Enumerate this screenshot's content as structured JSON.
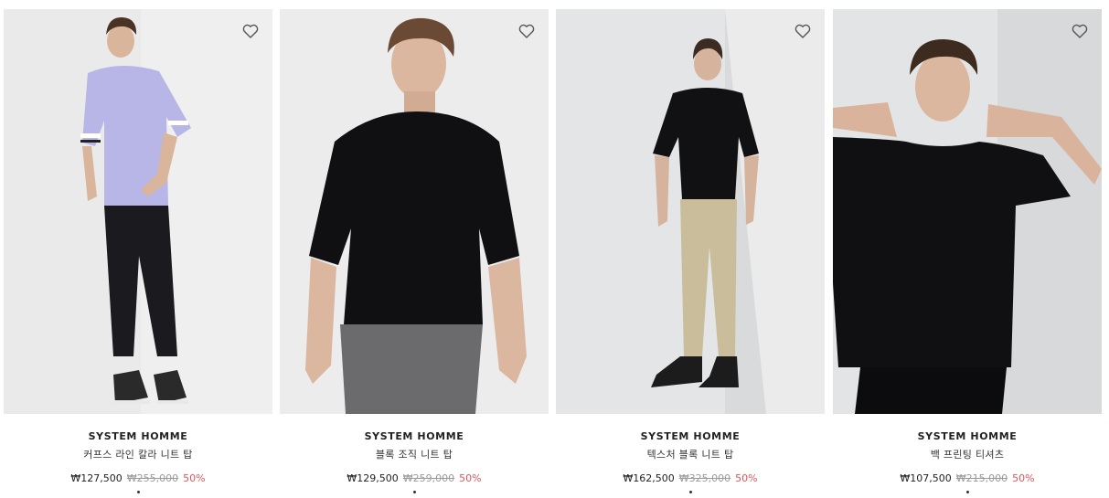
{
  "products": [
    {
      "brand": "SYSTEM HOMME",
      "name": "커프스 라인 칼라 니트 탑",
      "price": "₩127,500",
      "original_price": "₩255,000",
      "discount": "50%"
    },
    {
      "brand": "SYSTEM HOMME",
      "name": "블록 조직 니트 탑",
      "price": "₩129,500",
      "original_price": "₩259,000",
      "discount": "50%"
    },
    {
      "brand": "SYSTEM HOMME",
      "name": "텍스처 블록 니트 탑",
      "price": "₩162,500",
      "original_price": "₩325,000",
      "discount": "50%"
    },
    {
      "brand": "SYSTEM HOMME",
      "name": "백 프린팅 티셔츠",
      "price": "₩107,500",
      "original_price": "₩215,000",
      "discount": "50%"
    }
  ],
  "colors": {
    "discount": "#e0555a",
    "strike_price": "#9a9a9a",
    "text": "#222222",
    "heart_outline": "#555555"
  },
  "icons": {
    "wishlist": "heart-outline-icon"
  }
}
